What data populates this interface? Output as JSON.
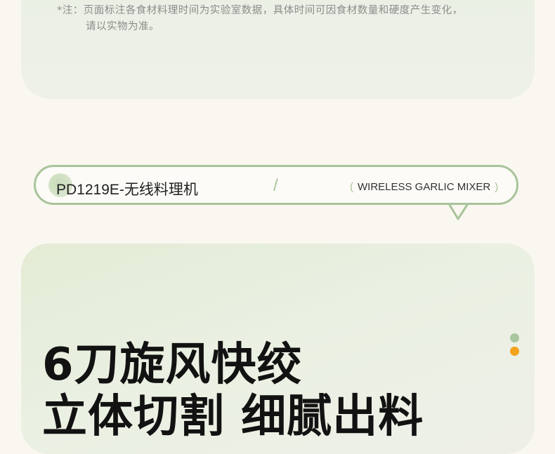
{
  "note": {
    "line1": "*注：页面标注各食材料理时间为实验室数据，具体时间可因食材数量和硬度产生变化，",
    "line2": "请以实物为准。"
  },
  "banner": {
    "title": "PD1219E-无线料理机",
    "slash": "/",
    "subtitle_open": "(",
    "subtitle": "WIRELESS GARLIC MIXER",
    "subtitle_close": ")"
  },
  "headline": {
    "line1": "6刀旋风快绞",
    "line2": "立体切割 细腻出料"
  },
  "colors": {
    "accent_green": "#a8c49a",
    "accent_orange": "#f3a21b"
  },
  "icons": [
    "chevron-down-icon",
    "page-indicator-dot"
  ]
}
